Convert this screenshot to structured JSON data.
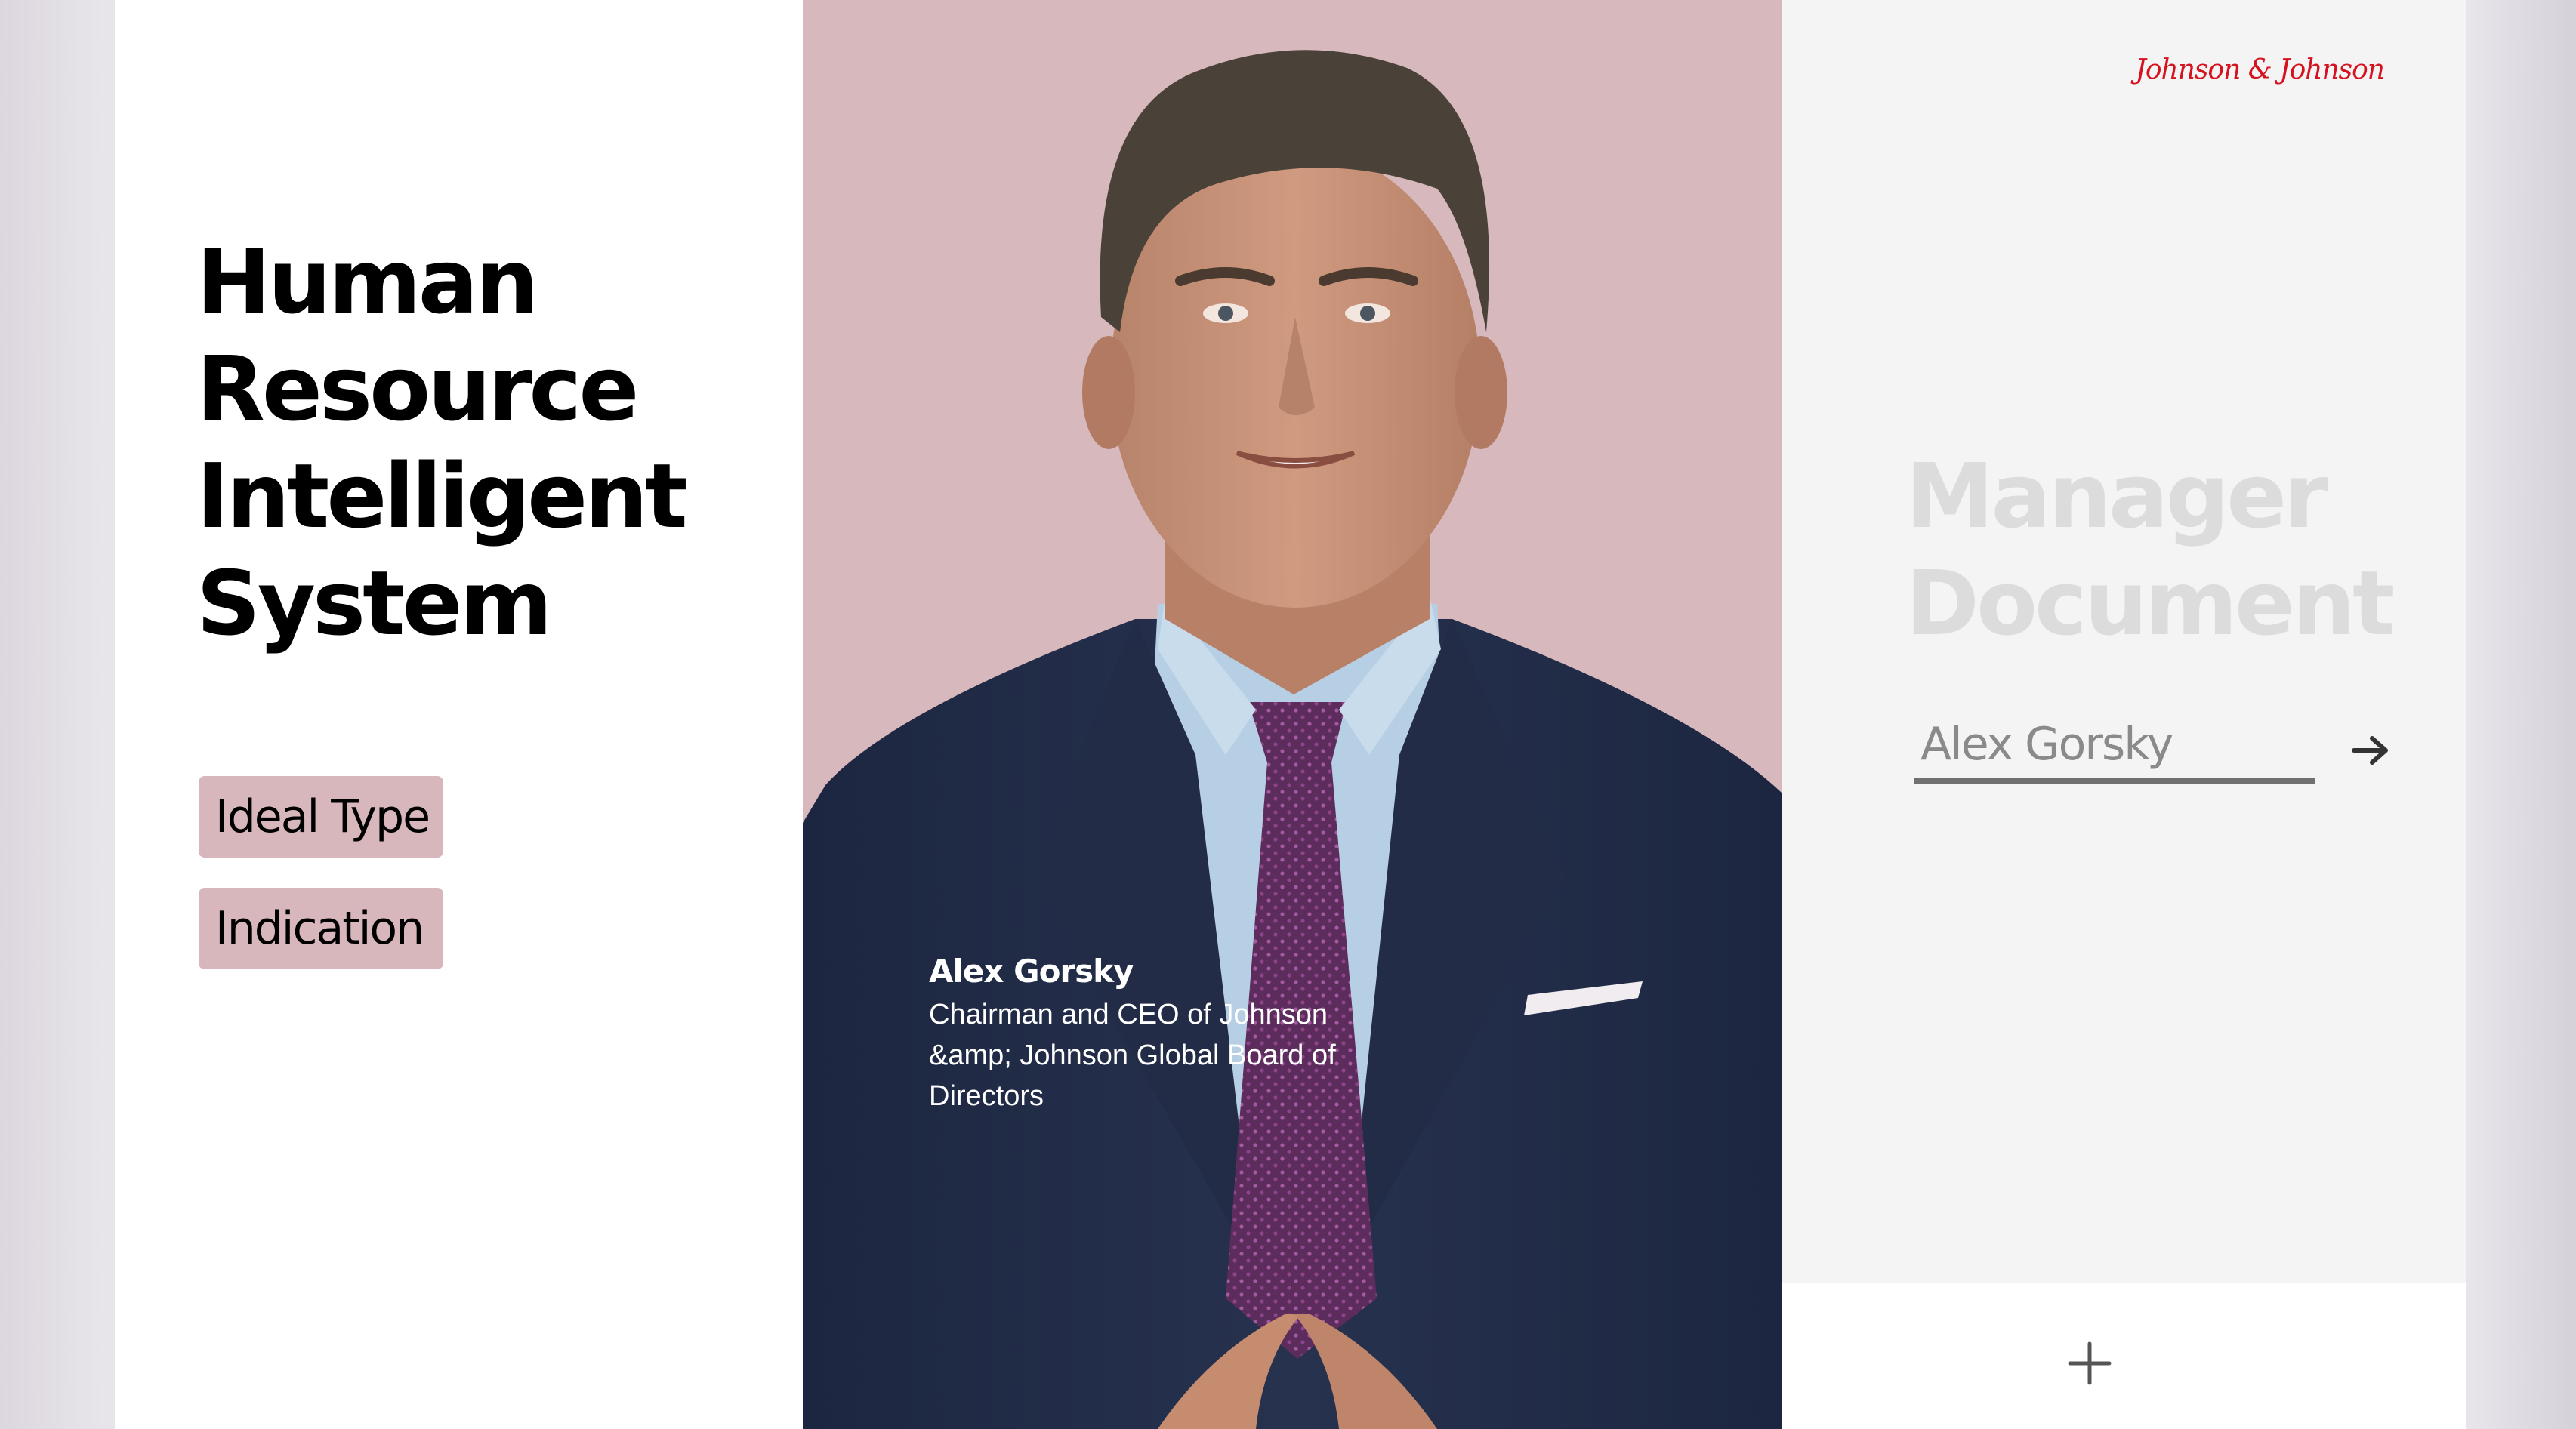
{
  "app": {
    "brand": "Johnson & Johnson",
    "brand_color": "#d5121e",
    "accent_color": "#d8b7bc"
  },
  "left": {
    "title_lines": [
      "Human",
      "Resource",
      "Intelligent",
      "System"
    ],
    "tags": [
      {
        "label": "Ideal Type"
      },
      {
        "label": "Indication"
      }
    ]
  },
  "profile": {
    "name": "Alex Gorsky",
    "role": "Chairman and CEO of Johnson &amp; Johnson Global Board of Directors",
    "photo_background": "#d7b8bc"
  },
  "right": {
    "title_lines": [
      "Manager",
      "Document"
    ],
    "input_value": "Alex Gorsky",
    "arrow_icon": "arrow-right-icon",
    "add_icon": "plus-icon"
  }
}
